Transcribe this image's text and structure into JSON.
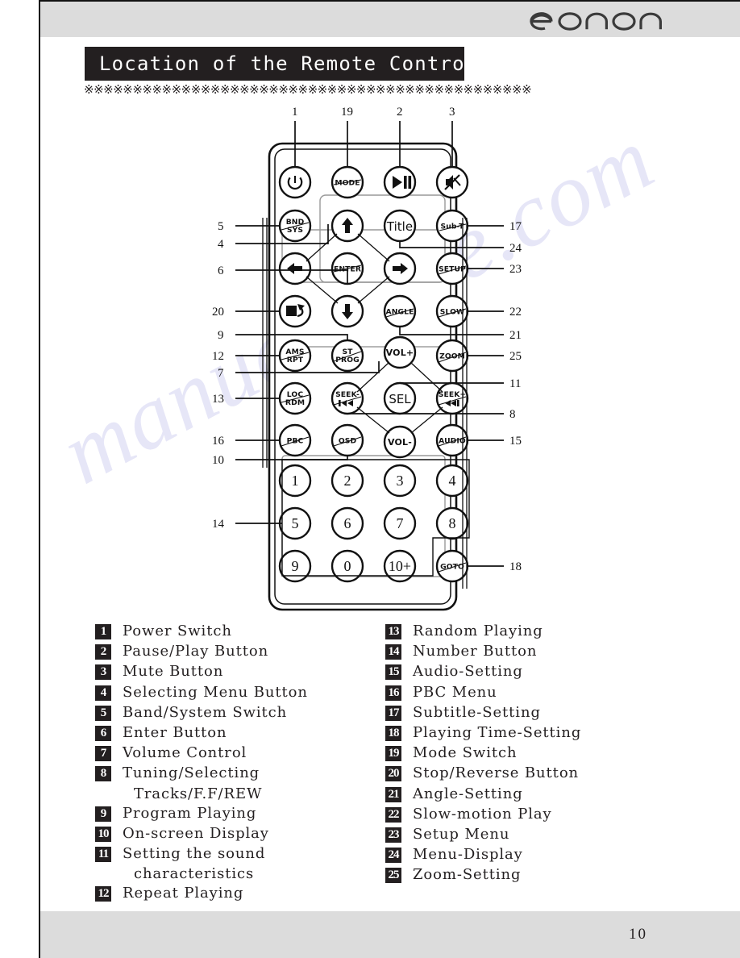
{
  "page": {
    "brand_logo": "eonon",
    "title": "Location of the Remote Control",
    "separator_row": "※※※※※※※※※※※※※※※※※※※※※※※※※※※※※※※※※※※※※※※※※※※※※※",
    "page_number": "10",
    "watermark": "manualshive.com"
  },
  "remote": {
    "buttons": [
      {
        "id": "power",
        "label": "",
        "icon": "power-icon",
        "callout": "1"
      },
      {
        "id": "mode",
        "label": "MODE",
        "icon": "text",
        "callout": "19"
      },
      {
        "id": "playpause",
        "label": "",
        "icon": "play-pause-icon",
        "callout": "2"
      },
      {
        "id": "mute",
        "label": "",
        "icon": "mute-icon",
        "callout": "3"
      },
      {
        "id": "bndsys",
        "label": "BND\nSYS",
        "icon": "text",
        "callout": "5"
      },
      {
        "id": "up",
        "label": "",
        "icon": "arrow-up-icon",
        "callout": "4"
      },
      {
        "id": "title",
        "label": "Title",
        "icon": "text",
        "callout": "24"
      },
      {
        "id": "subt",
        "label": "Sub-T",
        "icon": "text",
        "callout": "17"
      },
      {
        "id": "left",
        "label": "",
        "icon": "arrow-left-icon",
        "callout": "4"
      },
      {
        "id": "enter",
        "label": "ENTER",
        "icon": "text",
        "callout": "6"
      },
      {
        "id": "right",
        "label": "",
        "icon": "arrow-right-icon",
        "callout": "4"
      },
      {
        "id": "setup",
        "label": "SETUP",
        "icon": "text",
        "callout": "23"
      },
      {
        "id": "stop",
        "label": "",
        "icon": "stop-reverse-icon",
        "callout": "20"
      },
      {
        "id": "down",
        "label": "",
        "icon": "arrow-down-icon",
        "callout": "4"
      },
      {
        "id": "angle",
        "label": "ANGLE",
        "icon": "text",
        "callout": "21"
      },
      {
        "id": "slow",
        "label": "SLOW",
        "icon": "text",
        "callout": "22"
      },
      {
        "id": "amsrpt",
        "label": "AMS\nRPT",
        "icon": "text",
        "callout": "12"
      },
      {
        "id": "stprog",
        "label": "ST\nPROG",
        "icon": "text",
        "callout": "9"
      },
      {
        "id": "volup",
        "label": "VOL+",
        "icon": "text",
        "callout": "7"
      },
      {
        "id": "zoom",
        "label": "ZOOM",
        "icon": "text",
        "callout": "25"
      },
      {
        "id": "locrdm",
        "label": "LOC\nRDM",
        "icon": "text",
        "callout": "13"
      },
      {
        "id": "seekminus",
        "label": "SEEK-",
        "icon": "rewind-icon",
        "callout": "8"
      },
      {
        "id": "sel",
        "label": "SEL",
        "icon": "text",
        "callout": "11"
      },
      {
        "id": "seekplus",
        "label": "SEEK+",
        "icon": "fastforward-icon",
        "callout": "8"
      },
      {
        "id": "pbc",
        "label": "PBC",
        "icon": "text",
        "callout": "16"
      },
      {
        "id": "osd",
        "label": "OSD",
        "icon": "text",
        "callout": "10"
      },
      {
        "id": "voldown",
        "label": "VOL-",
        "icon": "text",
        "callout": "7"
      },
      {
        "id": "audio",
        "label": "AUDIO",
        "icon": "text",
        "callout": "15"
      },
      {
        "id": "num1",
        "label": "1",
        "icon": "text",
        "callout": "14"
      },
      {
        "id": "num2",
        "label": "2",
        "icon": "text",
        "callout": "14"
      },
      {
        "id": "num3",
        "label": "3",
        "icon": "text",
        "callout": "14"
      },
      {
        "id": "num4",
        "label": "4",
        "icon": "text",
        "callout": "14"
      },
      {
        "id": "num5",
        "label": "5",
        "icon": "text",
        "callout": "14"
      },
      {
        "id": "num6",
        "label": "6",
        "icon": "text",
        "callout": "14"
      },
      {
        "id": "num7",
        "label": "7",
        "icon": "text",
        "callout": "14"
      },
      {
        "id": "num8",
        "label": "8",
        "icon": "text",
        "callout": "14"
      },
      {
        "id": "num9",
        "label": "9",
        "icon": "text",
        "callout": "14"
      },
      {
        "id": "num0",
        "label": "0",
        "icon": "text",
        "callout": "14"
      },
      {
        "id": "num10plus",
        "label": "10+",
        "icon": "text",
        "callout": "14"
      },
      {
        "id": "goto",
        "label": "GOTO",
        "icon": "text",
        "callout": "18"
      }
    ],
    "callouts_top": [
      "1",
      "19",
      "2",
      "3"
    ],
    "callouts_left": [
      "5",
      "4",
      "6",
      "20",
      "9",
      "12",
      "7",
      "13",
      "16",
      "10",
      "14"
    ],
    "callouts_right": [
      "17",
      "24",
      "23",
      "22",
      "21",
      "25",
      "11",
      "8",
      "15",
      "18"
    ]
  },
  "legend": {
    "left": [
      {
        "num": "1",
        "label": "Power Switch"
      },
      {
        "num": "2",
        "label": "Pause/Play Button"
      },
      {
        "num": "3",
        "label": "Mute Button"
      },
      {
        "num": "4",
        "label": "Selecting Menu Button"
      },
      {
        "num": "5",
        "label": "Band/System Switch"
      },
      {
        "num": "6",
        "label": "Enter Button"
      },
      {
        "num": "7",
        "label": "Volume Control"
      },
      {
        "num": "8",
        "label": "Tuning/Selecting",
        "cont": "Tracks/F.F/REW"
      },
      {
        "num": "9",
        "label": "Program Playing"
      },
      {
        "num": "10",
        "label": "On-screen Display"
      },
      {
        "num": "11",
        "label": "Setting the sound",
        "cont": "characteristics"
      },
      {
        "num": "12",
        "label": "Repeat Playing"
      }
    ],
    "right": [
      {
        "num": "13",
        "label": "Random Playing"
      },
      {
        "num": "14",
        "label": "Number Button"
      },
      {
        "num": "15",
        "label": "Audio-Setting"
      },
      {
        "num": "16",
        "label": "PBC Menu"
      },
      {
        "num": "17",
        "label": "Subtitle-Setting"
      },
      {
        "num": "18",
        "label": "Playing Time-Setting"
      },
      {
        "num": "19",
        "label": "Mode Switch"
      },
      {
        "num": "20",
        "label": "Stop/Reverse Button"
      },
      {
        "num": "21",
        "label": "Angle-Setting"
      },
      {
        "num": "22",
        "label": "Slow-motion Play"
      },
      {
        "num": "23",
        "label": "Setup Menu"
      },
      {
        "num": "24",
        "label": "Menu-Display"
      },
      {
        "num": "25",
        "label": "Zoom-Setting"
      }
    ]
  },
  "colors": {
    "header_band": "#dcdcdc",
    "title_bar": "#231f20",
    "ink": "#231f20",
    "paper": "#ffffff"
  }
}
